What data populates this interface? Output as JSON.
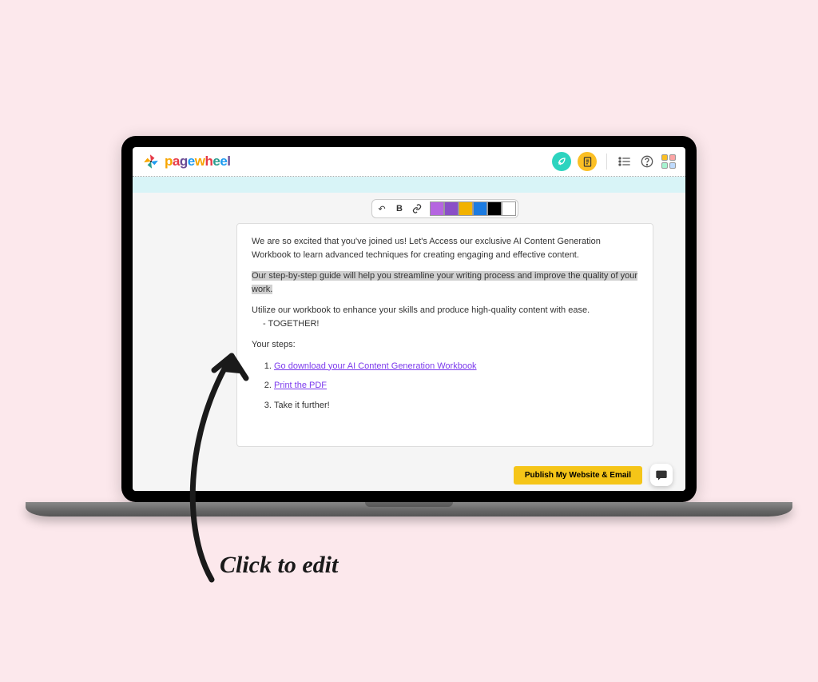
{
  "brand": {
    "name": "pagewheel"
  },
  "toolbar": {
    "buttons": {
      "undo": "↶",
      "bold": "B",
      "link": "🔗"
    },
    "swatches": [
      "#b565e0",
      "#8a4fc7",
      "#f2b200",
      "#1c7be0",
      "#000000",
      "#ffffff"
    ]
  },
  "content": {
    "p1": "We are so excited that you've joined us! Let's Access our exclusive AI Content Generation Workbook to learn advanced techniques for creating engaging and effective content.",
    "p2": "Our step-by-step guide will help you streamline your writing process and improve the quality of your work.",
    "p3": "Utilize our workbook to enhance your skills and produce high-quality content with ease.",
    "p3b": "  - TOGETHER!",
    "steps_label": "Your steps:",
    "steps": [
      {
        "text": "Go download your AI Content Generation Workbook",
        "link": true
      },
      {
        "text": "Print the PDF",
        "link": true
      },
      {
        "text": "Take it further!",
        "link": false
      }
    ]
  },
  "actions": {
    "publish": "Publish My Website & Email"
  },
  "annotation": {
    "label": "Click to edit"
  }
}
